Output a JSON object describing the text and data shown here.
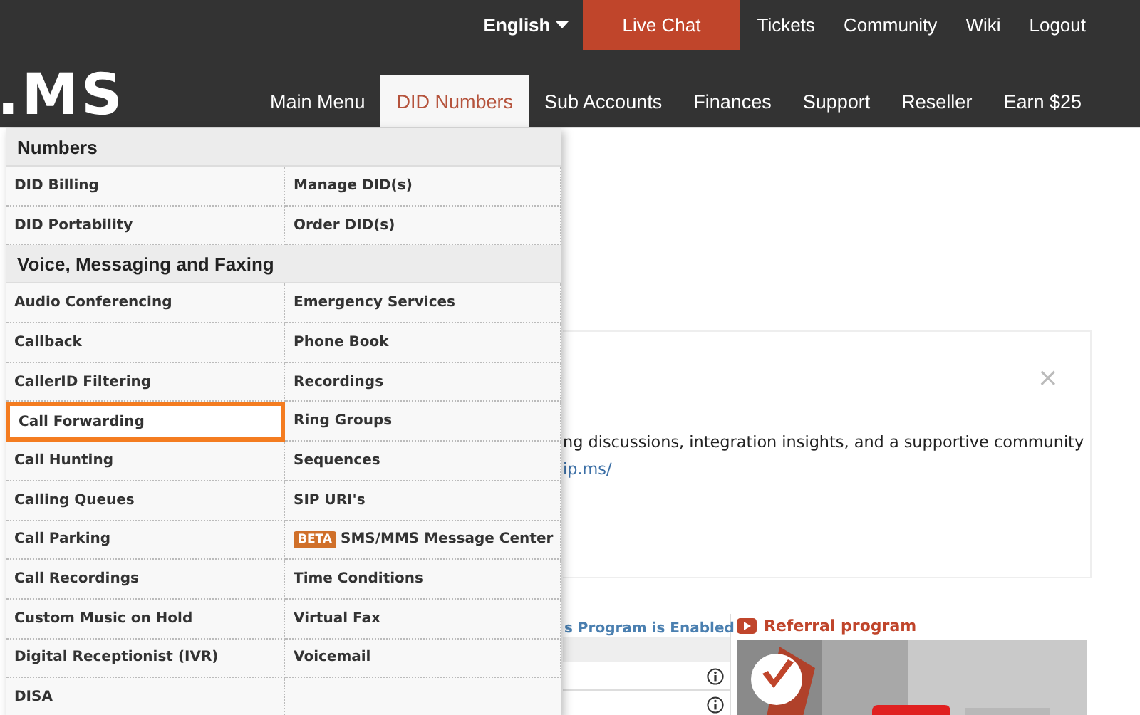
{
  "top_bar": {
    "language": "English",
    "links": [
      {
        "label": "Live Chat",
        "kind": "button"
      },
      {
        "label": "Tickets",
        "kind": "link"
      },
      {
        "label": "Community",
        "kind": "link"
      },
      {
        "label": "Wiki",
        "kind": "link"
      },
      {
        "label": "Logout",
        "kind": "link"
      }
    ]
  },
  "logo": ".MS",
  "nav": [
    {
      "label": "Main Menu",
      "selected": false
    },
    {
      "label": "DID Numbers",
      "selected": true
    },
    {
      "label": "Sub Accounts",
      "selected": false
    },
    {
      "label": "Finances",
      "selected": false
    },
    {
      "label": "Support",
      "selected": false
    },
    {
      "label": "Reseller",
      "selected": false
    },
    {
      "label": "Earn $25",
      "selected": false
    }
  ],
  "dropdown": {
    "sections": [
      {
        "title": "Numbers",
        "items": [
          {
            "label": "DID Billing",
            "highlighted": false
          },
          {
            "label": "Manage DID(s)",
            "highlighted": false
          },
          {
            "label": "DID Portability",
            "highlighted": false
          },
          {
            "label": "Order DID(s)",
            "highlighted": false
          }
        ]
      },
      {
        "title": "Voice, Messaging and Faxing",
        "items": [
          {
            "label": "Audio Conferencing",
            "highlighted": false
          },
          {
            "label": "Emergency Services",
            "highlighted": false
          },
          {
            "label": "Callback",
            "highlighted": false
          },
          {
            "label": "Phone Book",
            "highlighted": false
          },
          {
            "label": "CallerID Filtering",
            "highlighted": false
          },
          {
            "label": "Recordings",
            "highlighted": false
          },
          {
            "label": "Call Forwarding",
            "highlighted": true
          },
          {
            "label": "Ring Groups",
            "highlighted": false
          },
          {
            "label": "Call Hunting",
            "highlighted": false
          },
          {
            "label": "Sequences",
            "highlighted": false
          },
          {
            "label": "Calling Queues",
            "highlighted": false
          },
          {
            "label": "SIP URI's",
            "highlighted": false
          },
          {
            "label": "Call Parking",
            "highlighted": false
          },
          {
            "label": "SMS/MMS Message Center",
            "highlighted": false,
            "badge": "BETA"
          },
          {
            "label": "Call Recordings",
            "highlighted": false
          },
          {
            "label": "Time Conditions",
            "highlighted": false
          },
          {
            "label": "Custom Music on Hold",
            "highlighted": false
          },
          {
            "label": "Virtual Fax",
            "highlighted": false
          },
          {
            "label": "Digital Receptionist (IVR)",
            "highlighted": false
          },
          {
            "label": "Voicemail",
            "highlighted": false
          },
          {
            "label": "DISA",
            "highlighted": false
          }
        ]
      }
    ]
  },
  "notice": {
    "close": "×",
    "text": "ng discussions, integration insights, and a supportive community",
    "link": "ip.ms/"
  },
  "status_text": "s Program is Enabled",
  "referral": {
    "title": "Referral program"
  }
}
